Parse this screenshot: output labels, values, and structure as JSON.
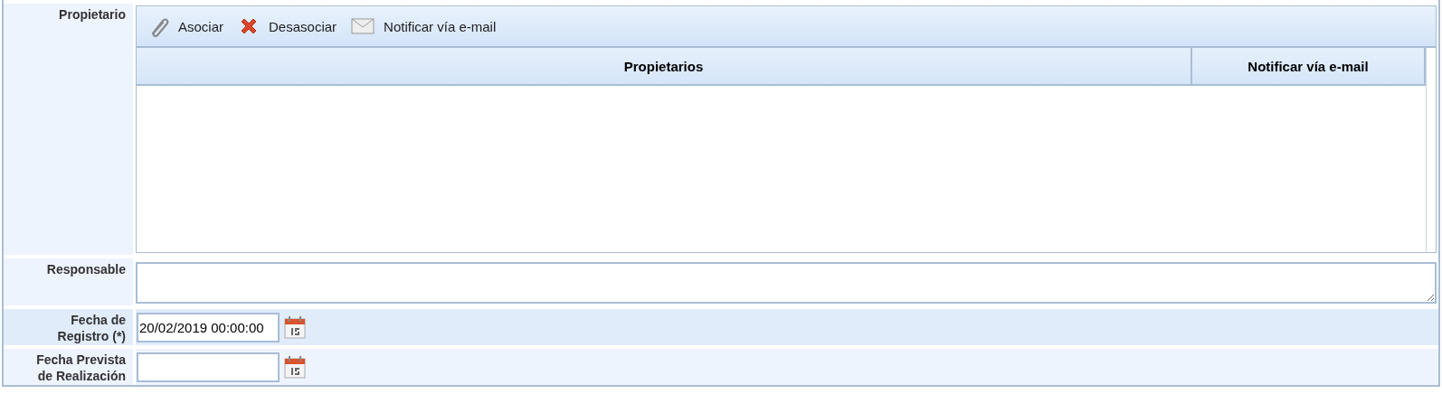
{
  "fields": [
    {
      "kind": "owners",
      "label": "Propietario",
      "toolbar": [
        {
          "kind": "associate",
          "label": "Asociar"
        },
        {
          "kind": "dissociate",
          "label": "Desasociar"
        },
        {
          "kind": "notify",
          "label": "Notificar vía e-mail"
        }
      ],
      "table": {
        "columns": [
          "Propietarios",
          "Notificar vía e-mail"
        ]
      }
    },
    {
      "kind": "textarea",
      "label": "Responsable"
    },
    {
      "kind": "date",
      "label": "Fecha de Registro (*)",
      "value": "20/02/2019 00:00:00"
    },
    {
      "kind": "date",
      "label": "Fecha Prevista de Realización"
    }
  ]
}
